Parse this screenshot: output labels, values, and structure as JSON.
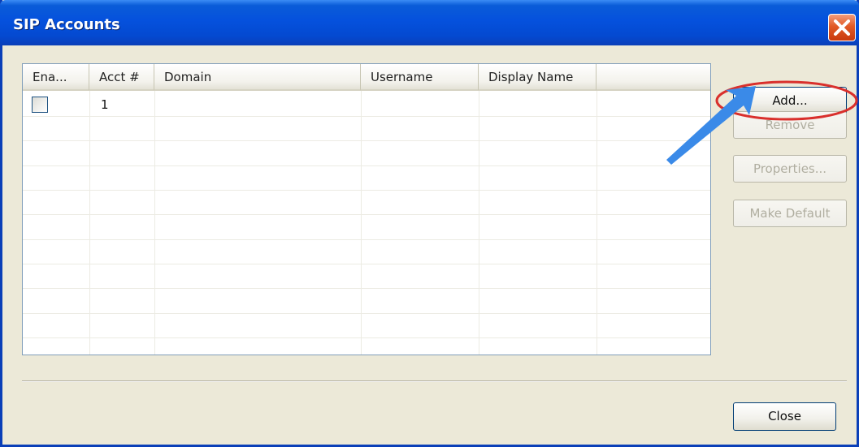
{
  "window": {
    "title": "SIP Accounts"
  },
  "table": {
    "columns": [
      "Ena...",
      "Acct #",
      "Domain",
      "Username",
      "Display Name"
    ],
    "rows": [
      {
        "enabled": false,
        "acct": "1",
        "domain": "",
        "username": "",
        "display_name": ""
      }
    ]
  },
  "buttons": {
    "add": "Add...",
    "remove": "Remove",
    "properties": "Properties...",
    "make_default": "Make Default",
    "close": "Close"
  },
  "annotation": {
    "circle_color": "#d9302c",
    "arrow_color": "#3a8ae8"
  }
}
